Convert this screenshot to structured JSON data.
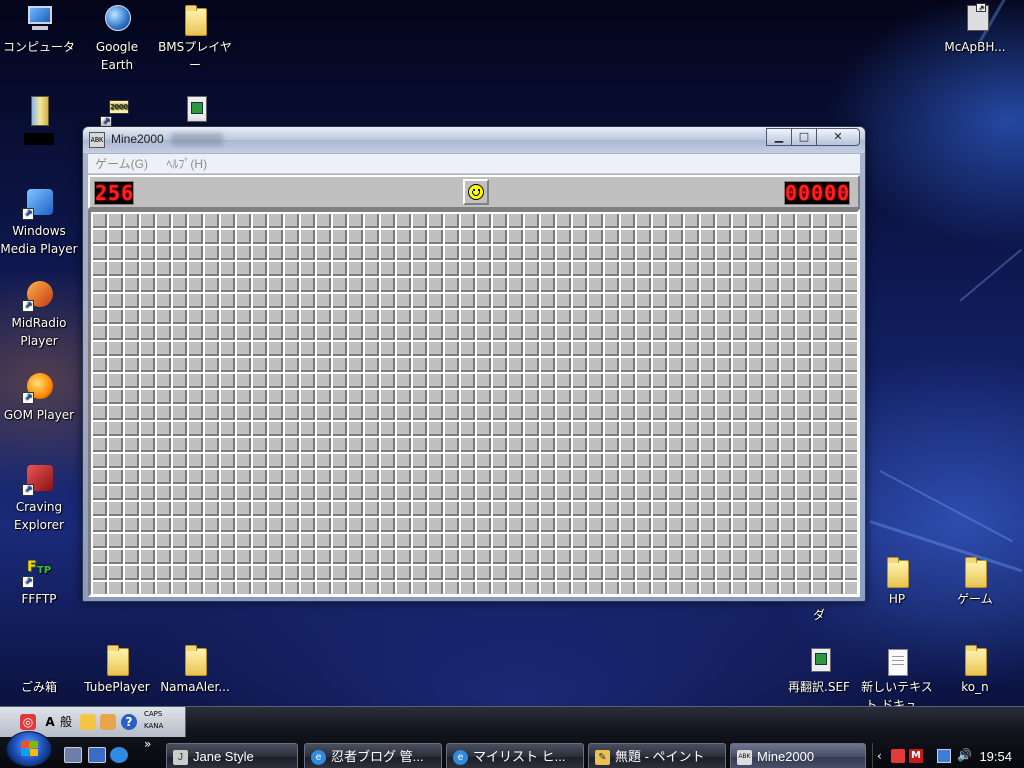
{
  "desktop": {
    "icons_left": [
      {
        "label": "コンピュータ"
      },
      {
        "label": "Google Earth"
      },
      {
        "label": "BMSプレイヤー"
      },
      {
        "label": "Windows Media Player"
      },
      {
        "label": "MidRadio Player"
      },
      {
        "label": "GOM Player"
      },
      {
        "label": "Craving Explorer"
      },
      {
        "label": "FFFTP"
      },
      {
        "label": "ごみ箱"
      },
      {
        "label": "TubePlayer"
      },
      {
        "label": "NamaAler..."
      }
    ],
    "icons_right": [
      {
        "label": "McApBH..."
      },
      {
        "label": "ダ"
      },
      {
        "label": "HP"
      },
      {
        "label": "ゲーム"
      },
      {
        "label": "再翻訳.SEF"
      },
      {
        "label": "新しいテキスト ドキュ..."
      },
      {
        "label": "ko_n"
      }
    ],
    "icon_redacted_label": ""
  },
  "window": {
    "title": "Mine2000",
    "app_icon_text": "ABK",
    "minimize_glyph": "▁",
    "maximize_glyph": "□",
    "close_glyph": "✕",
    "menu": [
      "ゲーム(G)",
      "ﾍﾙﾌﾟ(H)"
    ],
    "mine_counter": "256",
    "timer": "00000",
    "grid": {
      "columns": 48,
      "rows": 24,
      "state": "all covered"
    }
  },
  "taskbar": {
    "langbar": {
      "ime_mode": "A",
      "ime_label": "般",
      "caps": "CAPS",
      "kana": "KANA"
    },
    "tasks": [
      {
        "label": "Jane Style",
        "icon": "jane-icon"
      },
      {
        "label": "忍者ブログ 管...",
        "icon": "ie-icon"
      },
      {
        "label": "マイリスト ヒ...",
        "icon": "ie-icon"
      },
      {
        "label": "無題 - ペイント",
        "icon": "paint-icon"
      },
      {
        "label": "Mine2000",
        "icon": "mine-icon"
      }
    ],
    "more_arrows": "»",
    "clock": "19:54"
  }
}
